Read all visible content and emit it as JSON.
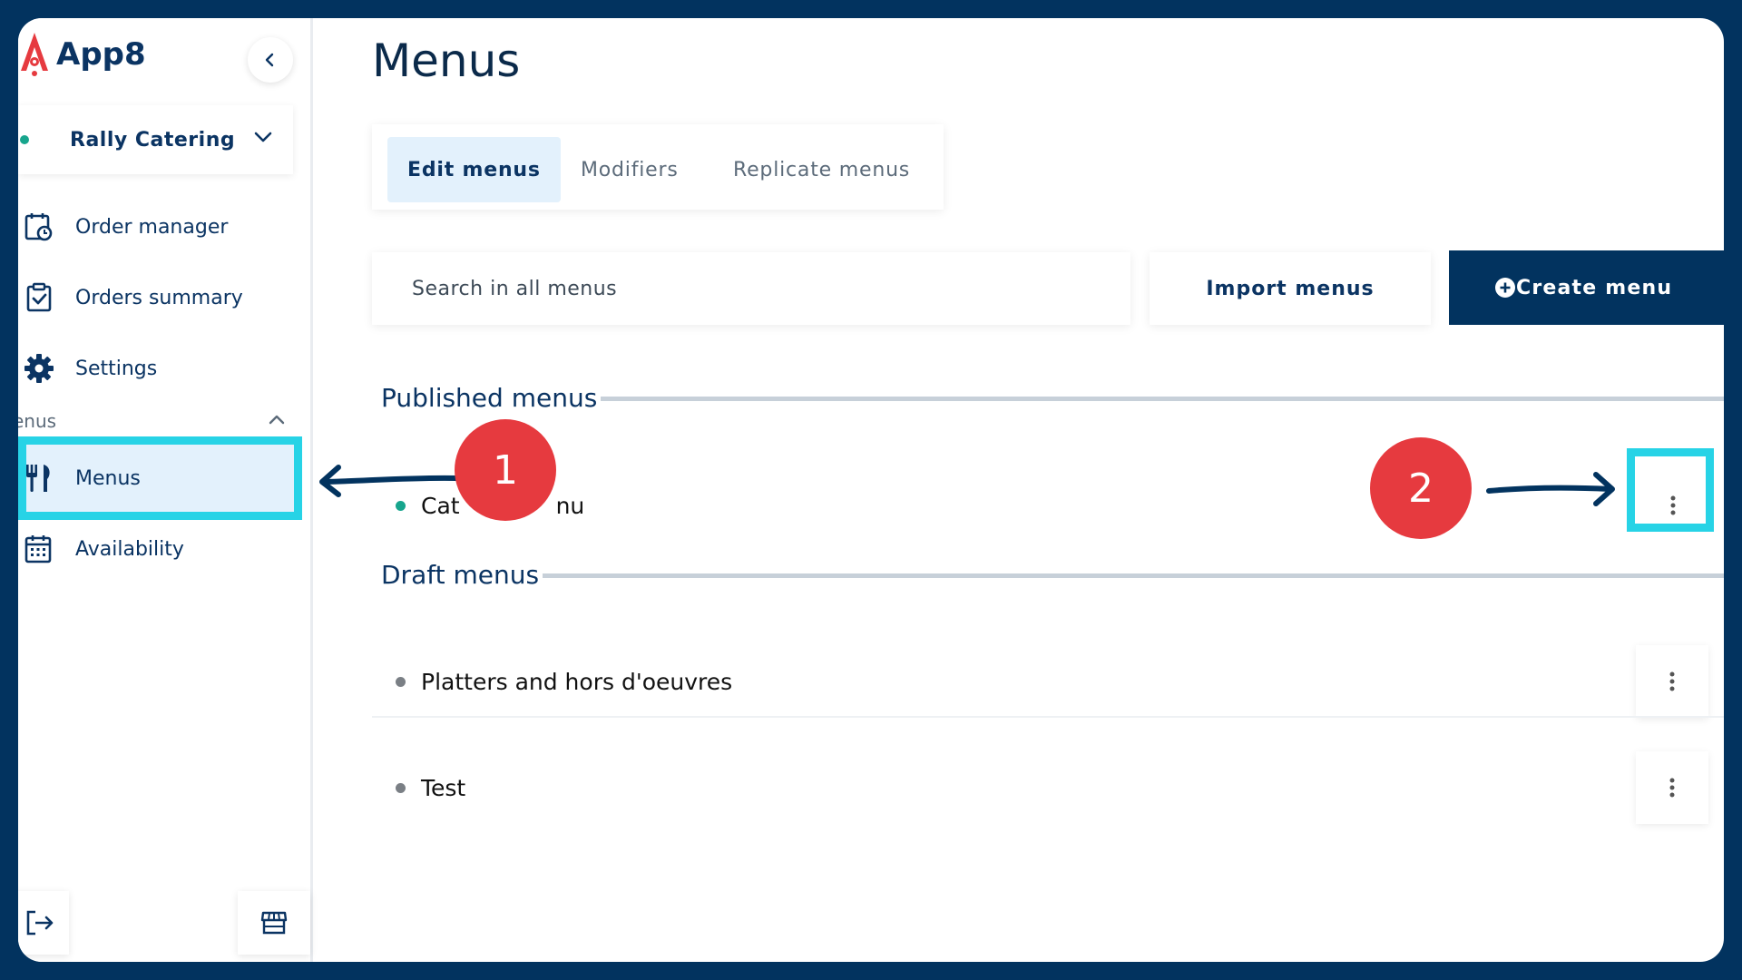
{
  "app": {
    "name": "App8"
  },
  "account": {
    "name": "Rally Catering"
  },
  "sidebar": {
    "items": [
      {
        "label": "Order manager"
      },
      {
        "label": "Orders summary"
      },
      {
        "label": "Settings"
      },
      {
        "label": "Menus"
      },
      {
        "label": "Availability"
      }
    ],
    "section_label": "enus"
  },
  "page": {
    "title": "Menus"
  },
  "tabs": [
    {
      "label": "Edit menus",
      "active": true
    },
    {
      "label": "Modifiers",
      "active": false
    },
    {
      "label": "Replicate menus",
      "active": false
    }
  ],
  "toolbar": {
    "search_placeholder": "Search in all menus",
    "import_label": "Import menus",
    "create_label": "Create menu"
  },
  "published": {
    "heading": "Published menus",
    "menus": [
      {
        "name_left": "Cat",
        "name_right": "nu",
        "status": "published"
      }
    ]
  },
  "drafts": {
    "heading": "Draft menus",
    "menus": [
      {
        "name": "Platters and hors d'oeuvres"
      },
      {
        "name": "Test"
      }
    ]
  },
  "annotations": {
    "step1": "1",
    "step2": "2"
  },
  "colors": {
    "brand_navy": "#02335f",
    "highlight_cyan": "#27d3e6",
    "step_red": "#e63a3f",
    "active_bg": "#e3f1fc",
    "status_green": "#17a58d"
  }
}
